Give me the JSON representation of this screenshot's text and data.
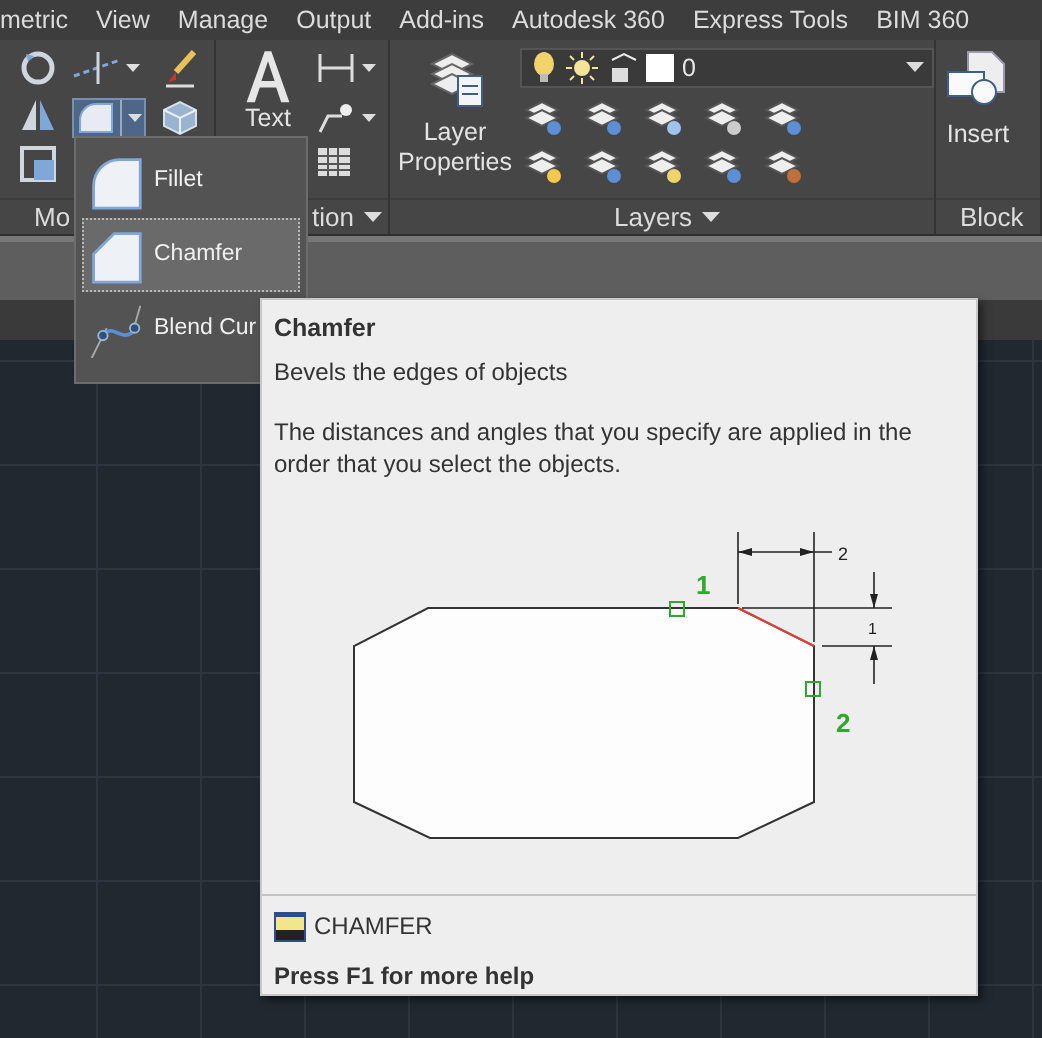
{
  "menu_tabs": [
    {
      "label": "metric"
    },
    {
      "label": "View"
    },
    {
      "label": "Manage"
    },
    {
      "label": "Output"
    },
    {
      "label": "Add-ins"
    },
    {
      "label": "Autodesk 360"
    },
    {
      "label": "Express Tools"
    },
    {
      "label": "BIM 360"
    }
  ],
  "ribbon": {
    "panels": [
      {
        "title": "Mo",
        "has_caret": false
      },
      {
        "title": "tion",
        "has_caret": true
      },
      {
        "title": "Layers",
        "has_caret": true
      },
      {
        "title": "Block",
        "has_caret": false
      }
    ],
    "text_button": {
      "label": "Text"
    },
    "layer_properties": {
      "label": "Layer Properties"
    },
    "layer_combo": {
      "value": "0"
    },
    "insert": {
      "label": "Insert"
    }
  },
  "dropdown": {
    "items": [
      {
        "label": "Fillet",
        "selected": false
      },
      {
        "label": "Chamfer",
        "selected": true
      },
      {
        "label": "Blend Cur",
        "selected": false
      }
    ]
  },
  "tooltip": {
    "title": "Chamfer",
    "summary": "Bevels the edges of objects",
    "description": "The distances and angles that you specify are applied in the order that you select the objects.",
    "diagram": {
      "pick_labels": [
        "1",
        "2"
      ],
      "dimension_labels": [
        "2",
        "1"
      ]
    },
    "command": "CHAMFER",
    "help": "Press F1 for more help"
  }
}
